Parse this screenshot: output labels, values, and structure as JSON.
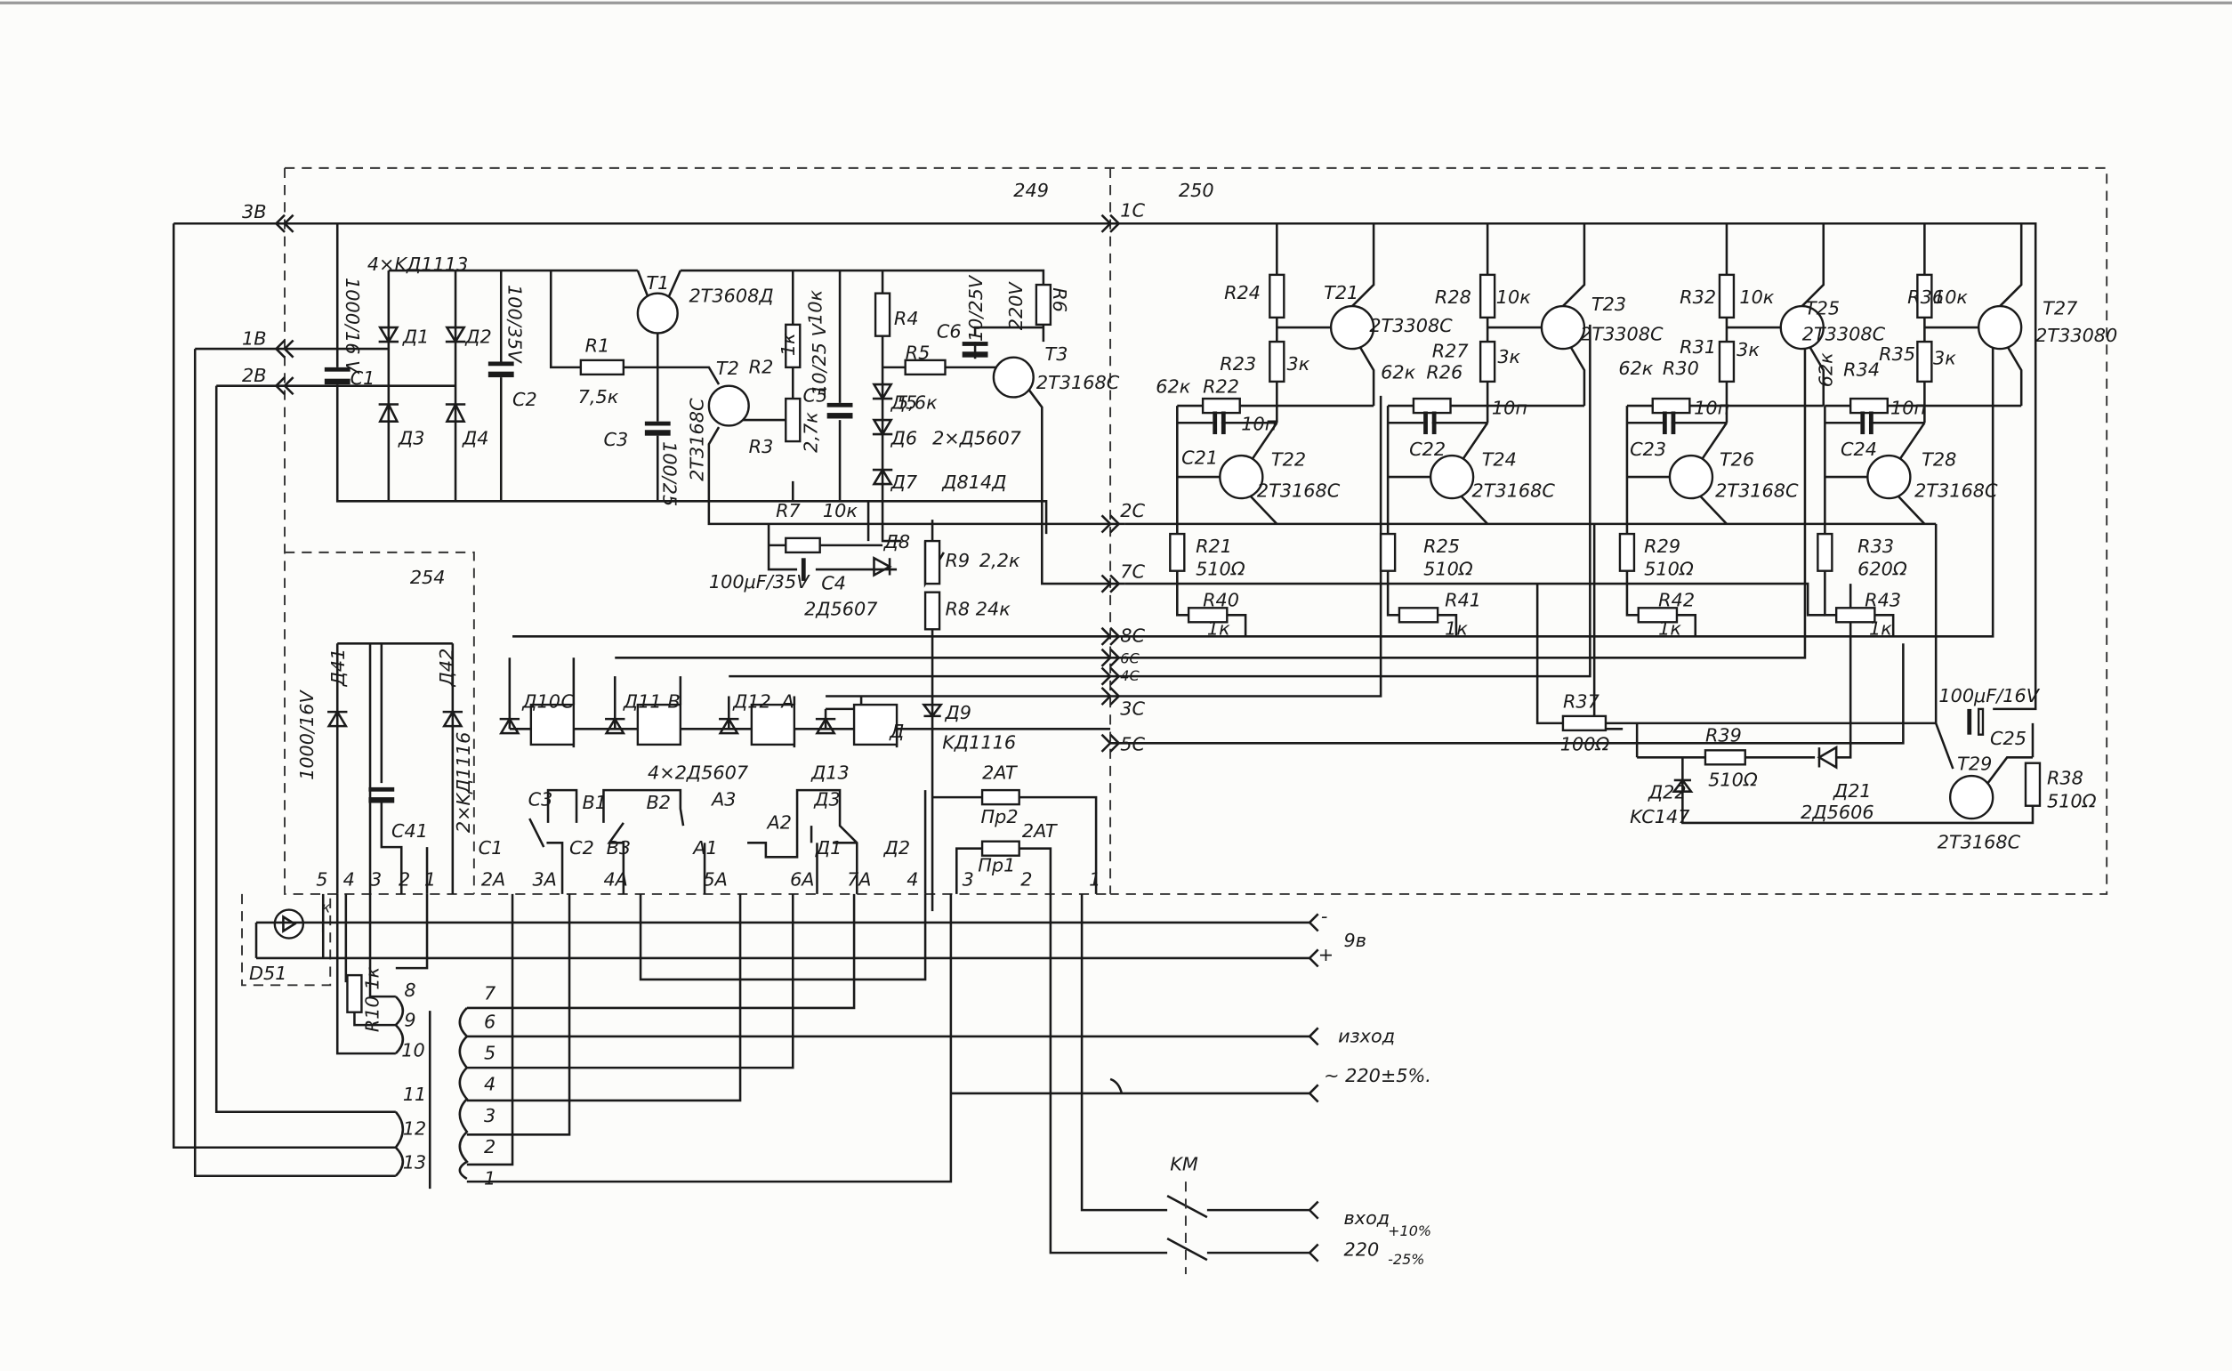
{
  "blocks": {
    "b249": "249",
    "b250": "250",
    "b254": "254",
    "d51": "D51"
  },
  "connectors": {
    "c3B": "3B",
    "c1B": "1B",
    "c2B": "2B",
    "c1C": "1C",
    "c2C": "2C",
    "c7C": "7C",
    "c8C": "8C",
    "c6C": "6C",
    "c4C": "4C",
    "c3C": "3C",
    "c5C": "5C"
  },
  "supply": {
    "bridge": "4×KД1113",
    "c1_val": "1000/16 V",
    "c1": "C1",
    "d1": "Д1",
    "d2": "Д2",
    "d3": "Д3",
    "d4": "Д4",
    "c2_val": "100/35V",
    "c2": "C2"
  },
  "regulator": {
    "r1": "R1",
    "r1_val": "7,5к",
    "t1": "T1",
    "t1_type": "2T3608Д",
    "t2": "T2",
    "t2_type": "2T3168C",
    "c3": "C3",
    "c3_val": "100/25",
    "r2": "R2",
    "r2_val": "1к",
    "c5": "C5",
    "c5_val": "10/25 V",
    "r4_val": "10к",
    "r3": "R3",
    "r3_val": "2,7к",
    "r4": "R4",
    "r5": "R5",
    "r5_val": "5,6к",
    "c6": "C6",
    "c6_val": "10/25V",
    "r6_val": "220V",
    "r6": "R6",
    "t3": "T3",
    "t3_type": "2T3168C",
    "d5": "Д5",
    "d6": "Д6",
    "d56_type": "2×Д5607",
    "d7": "Д7",
    "d7_type": "Д814Д",
    "r7": "R7",
    "r7_val": "10к",
    "d8": "Д8",
    "r9": "R9",
    "r9_val": "2,2к",
    "c4_val": "100μF/35V",
    "c4": "C4",
    "d8_type": "2Д5607",
    "r8": "R8 24к"
  },
  "stages": [
    {
      "r_top": "R24",
      "r_top_val": "",
      "r_mid": "R23",
      "r_mid_val": "3к",
      "r_fb": "R22",
      "r_fb_val": "62к",
      "cap": "C21",
      "cap_val": "10п",
      "t_out": "T21",
      "t_out_type": "2T3308C",
      "t_in": "T22",
      "t_in_type": "2T3168C",
      "r_e": "R21",
      "r_e_val": "510Ω",
      "pot": "R40",
      "pot_val": "1к"
    },
    {
      "r_top": "R28",
      "r_top_val": "10к",
      "r_mid": "R27",
      "r_mid_val": "3к",
      "r_fb": "R26",
      "r_fb_val": "62к",
      "cap": "C22",
      "cap_val": "10п",
      "t_out": "T23",
      "t_out_type": "2T3308C",
      "t_in": "T24",
      "t_in_type": "2T3168C",
      "r_e": "R25",
      "r_e_val": "510Ω",
      "pot": "R41",
      "pot_val": "1к"
    },
    {
      "r_top": "R32",
      "r_top_val": "10к",
      "r_mid": "R31",
      "r_mid_val": "3к",
      "r_fb": "R30",
      "r_fb_val": "62к",
      "cap": "C23",
      "cap_val": "10п",
      "t_out": "T25",
      "t_out_type": "2T3308C",
      "t_in": "T26",
      "t_in_type": "2T3168C",
      "r_e": "R29",
      "r_e_val": "510Ω",
      "pot": "R42",
      "pot_val": "1к"
    },
    {
      "r_top": "R36",
      "r_top_val": "10к",
      "r_mid": "R35",
      "r_mid_val": "3к",
      "r_fb": "R34",
      "r_fb_val": "62к",
      "cap": "C24",
      "cap_val": "10п",
      "t_out": "T27",
      "t_out_type": "2T33080",
      "t_in": "T28",
      "t_in_type": "2T3168C",
      "r_e": "R33",
      "r_e_val": "620Ω",
      "pot": "R43",
      "pot_val": "1к"
    }
  ],
  "timer": {
    "r37": "R37",
    "r37_val": "100Ω",
    "r39": "R39",
    "r39_val": "510Ω",
    "d21": "Д21",
    "d21_type": "2Д5606",
    "d22": "Д22",
    "d22_type": "KC147",
    "c25_val": "100μF/16V",
    "c25": "C25",
    "t29": "T29",
    "t29_type": "2T3168C",
    "r38": "R38",
    "r38_val": "510Ω"
  },
  "relays": {
    "d10": "Д10",
    "k_c": "C",
    "d11": "Д11",
    "k_b": "B",
    "d12": "Д12",
    "k_a": "A",
    "k_d": "Д",
    "d9": "Д9",
    "d9_type": "KД1116",
    "diodes": "4×2Д5607",
    "d13": "Д13",
    "contacts": {
      "c3": "C3",
      "b1": "B1",
      "b2": "B2",
      "a3": "A3",
      "a2": "A2",
      "dd3": "Д3",
      "c2": "C2",
      "b3": "B3",
      "a1": "A1",
      "dd1": "Д1",
      "dd2": "Д2",
      "c1": "C1"
    },
    "fuse2_rating": "2AT",
    "fuse2": "Пр2",
    "fuse1_rating": "2AT",
    "fuse1": "Пр1"
  },
  "block254": {
    "d41": "Д41",
    "d42": "Д42",
    "c41_val": "1000/16V",
    "c41": "C41",
    "diodes": "2×KД1116",
    "k": "к",
    "r10": "R10 1к"
  },
  "pins": {
    "left": [
      "5",
      "4",
      "3",
      "2",
      "1"
    ],
    "main": [
      "2A",
      "3A",
      "4A",
      "5A",
      "6A",
      "7A",
      "4",
      "3",
      "2",
      "1"
    ]
  },
  "transformer": {
    "secondary_a": [
      "8",
      "9",
      "10"
    ],
    "secondary_b": [
      "11",
      "12",
      "13"
    ],
    "primary": [
      "7",
      "6",
      "5",
      "4",
      "3",
      "2",
      "1"
    ]
  },
  "terminals": {
    "minus": "-",
    "plus": "+",
    "battery": "9в",
    "output": "изход",
    "output_spec": "~ 220±5%.",
    "switch": "KM",
    "input": "вход",
    "input_v": "220",
    "input_tol_plus": "+10%",
    "input_tol_minus": "-25%"
  }
}
